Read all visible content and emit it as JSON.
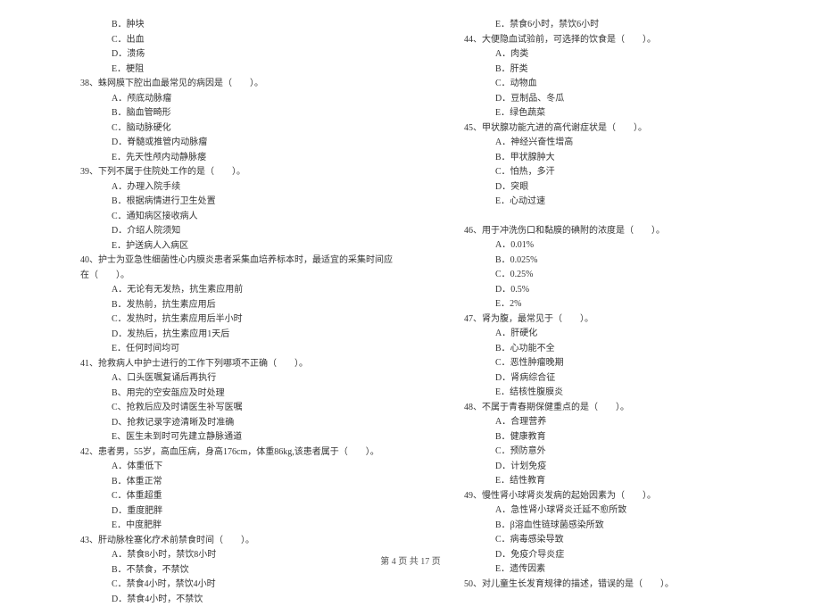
{
  "left_column": {
    "pre_options": [
      "B．肿块",
      "C．出血",
      "D．溃疡",
      "E．梗阻"
    ],
    "questions": [
      {
        "num": "38、",
        "text": "蛛网膜下腔出血最常见的病因是（　　）。",
        "options": [
          "A．颅底动脉瘤",
          "B．脑血管畸形",
          "C．脑动脉硬化",
          "D．脊髓或推管内动脉瘤",
          "E．先天性颅内动静脉瘘"
        ]
      },
      {
        "num": "39、",
        "text": "下列不属于住院处工作的是（　　）。",
        "options": [
          "A．办理入院手续",
          "B．根据病情进行卫生处置",
          "C．通知病区接收病人",
          "D．介绍人院须知",
          "E．护送病人入病区"
        ]
      },
      {
        "num": "40、",
        "text": "护士为亚急性细菌性心内膜炎患者采集血培养标本时，最适宜的采集时间应在（　　）。",
        "options": [
          "A．无论有无发热，抗生素应用前",
          "B．发热前，抗生素应用后",
          "C．发热时，抗生素应用后半小时",
          "D．发热后，抗生素应用1天后",
          "E．任何时间均可"
        ]
      },
      {
        "num": "41、",
        "text": "抢救病人中护士进行的工作下列哪项不正确（　　）。",
        "options": [
          "A、口头医嘱复诵后再执行",
          "B、用完的空安瓿应及时处理",
          "C、抢救后应及时请医生补写医嘱",
          "D、抢救记录字迹清晰及时准确",
          "E、医生未到时可先建立静脉通道"
        ]
      },
      {
        "num": "42、",
        "text": "患者男，55岁，高血压病，身高176cm，体重86kg,该患者属于（　　）。",
        "options": [
          "A．体重低下",
          "B．体重正常",
          "C．体重超重",
          "D．重度肥胖",
          "E．中度肥胖"
        ]
      },
      {
        "num": "43、",
        "text": "肝动脉栓塞化疗术前禁食时间（　　）。",
        "options": [
          "A．禁食8小时，禁饮8小时",
          "B．不禁食，不禁饮",
          "C．禁食4小时，禁饮4小时",
          "D．禁食4小时，不禁饮"
        ]
      }
    ]
  },
  "right_column": {
    "pre_options": [
      "E．禁食6小时，禁饮6小时"
    ],
    "questions": [
      {
        "num": "44、",
        "text": "大便隐血试验前，可选择的饮食是（　　）。",
        "options": [
          "A．肉类",
          "B．肝类",
          "C．动物血",
          "D．豆制品、冬瓜",
          "E．绿色蔬菜"
        ]
      },
      {
        "num": "45、",
        "text": "甲状腺功能亢进的高代谢症状是（　　）。",
        "options": [
          "A．神经兴奋性增高",
          "B．甲状腺肿大",
          "C．怕热，多汗",
          "D．突眼",
          "E．心动过速"
        ]
      },
      {
        "num": "46、",
        "text": "用于冲洗伤口和黏膜的碘附的浓度是（　　）。",
        "options": [
          "A．0.01%",
          "B．0.025%",
          "C．0.25%",
          "D．0.5%",
          "E．2%"
        ],
        "pre_blank": true
      },
      {
        "num": "47、",
        "text": "肾为腹，最常见于（　　）。",
        "options": [
          "A．肝硬化",
          "B．心功能不全",
          "C．恶性肿瘤晚期",
          "D．肾病综合征",
          "E．结核性腹膜炎"
        ]
      },
      {
        "num": "48、",
        "text": "不属于青春期保健重点的是（　　）。",
        "options": [
          "A．合理营养",
          "B．健康教育",
          "C．预防意外",
          "D．计划免疫",
          "E．结性教育"
        ]
      },
      {
        "num": "49、",
        "text": "慢性肾小球肾炎发病的起始因素为（　　）。",
        "options": [
          "A．急性肾小球肾炎迁延不愈所致",
          "B．β溶血性链球菌感染所致",
          "C．病毒感染导致",
          "D．免疫介导炎症",
          "E．遗传因素"
        ]
      },
      {
        "num": "50、",
        "text": "对儿童生长发育规律的描述，错误的是（　　）。",
        "options": []
      }
    ]
  },
  "footer": "第 4 页 共 17 页"
}
